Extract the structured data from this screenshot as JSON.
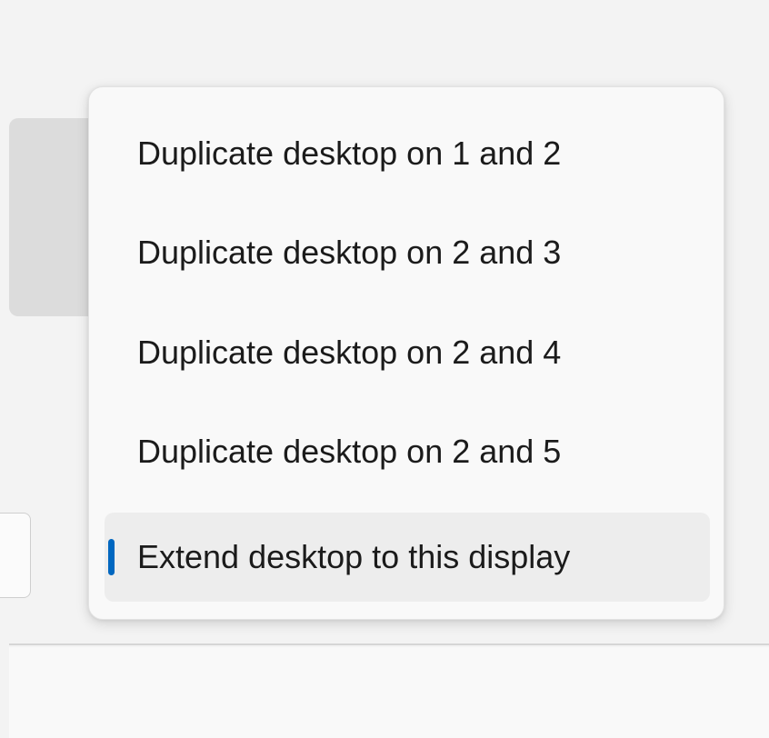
{
  "menu": {
    "items": [
      {
        "label": "Duplicate desktop on 1 and 2",
        "selected": false
      },
      {
        "label": "Duplicate desktop on 2 and 3",
        "selected": false
      },
      {
        "label": "Duplicate desktop on 2 and 4",
        "selected": false
      },
      {
        "label": "Duplicate desktop on 2 and 5",
        "selected": false
      },
      {
        "label": "Extend desktop to this display",
        "selected": true
      }
    ]
  },
  "colors": {
    "accent": "#0067c0",
    "menu_background": "#f9f9f9",
    "selected_background": "#ededed"
  }
}
